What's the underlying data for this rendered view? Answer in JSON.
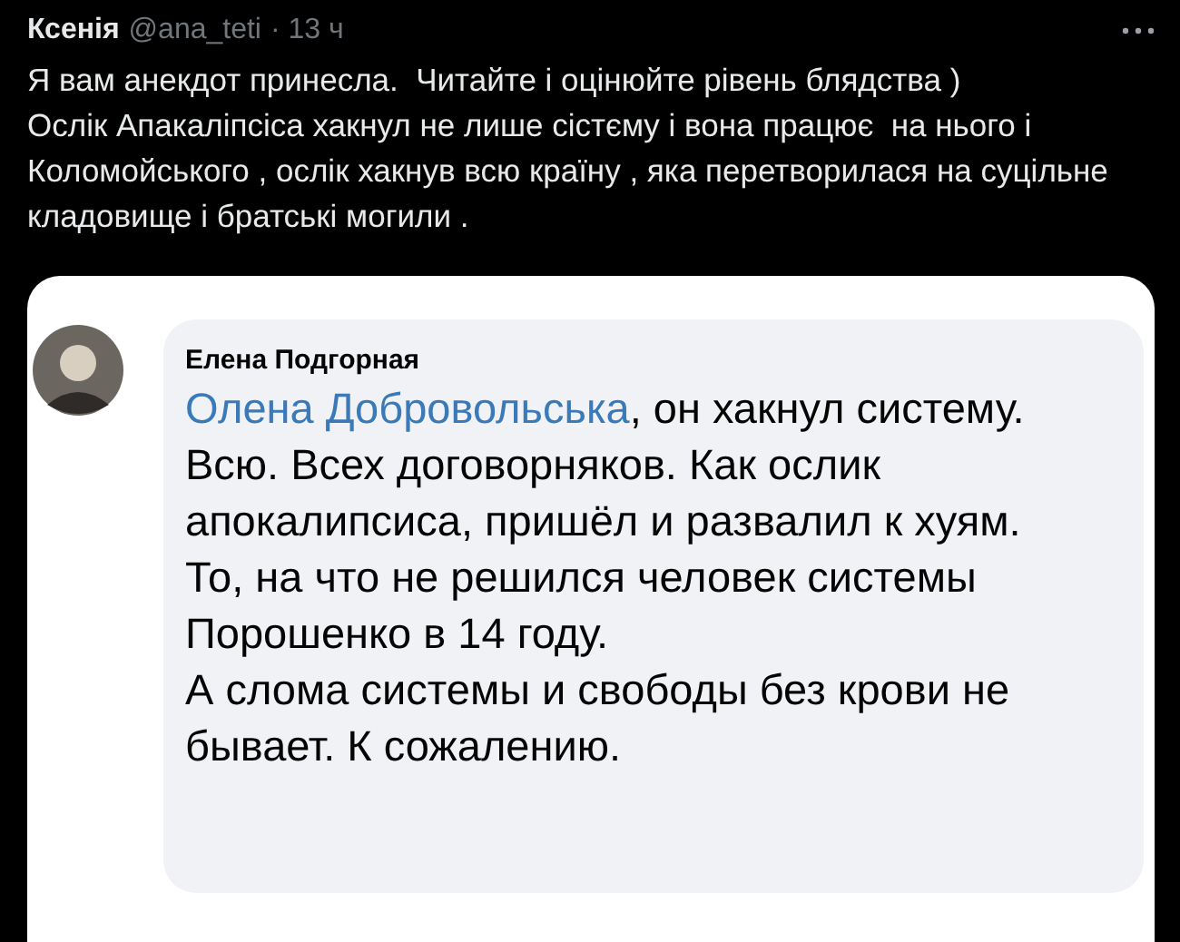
{
  "tweet": {
    "author": "Ксенія",
    "handle": "@ana_teti",
    "time": "· 13 ч",
    "paragraphs": [
      "Я вам анекдот принесла.  Читайте і оцінюйте рівень блядства )",
      "Ослік Апакаліпсіса хакнул не лише сістєму і вона працює  на нього і Коломойського , ослік хакнув всю країну , яка перетворилася на суцільне кладовище і братські могили ."
    ]
  },
  "comment": {
    "author": "Елена Подгорная",
    "mention": "Олена Добровольська",
    "paragraphs": [
      ", он хакнул систему. Всю. Всех договорняков. Как ослик апокалипсиса, пришёл и развалил к хуям.",
      "То, на что не решился человек системы Порошенко в 14 году.",
      "А слома системы и свободы без крови не бывает. К сожалению."
    ]
  }
}
